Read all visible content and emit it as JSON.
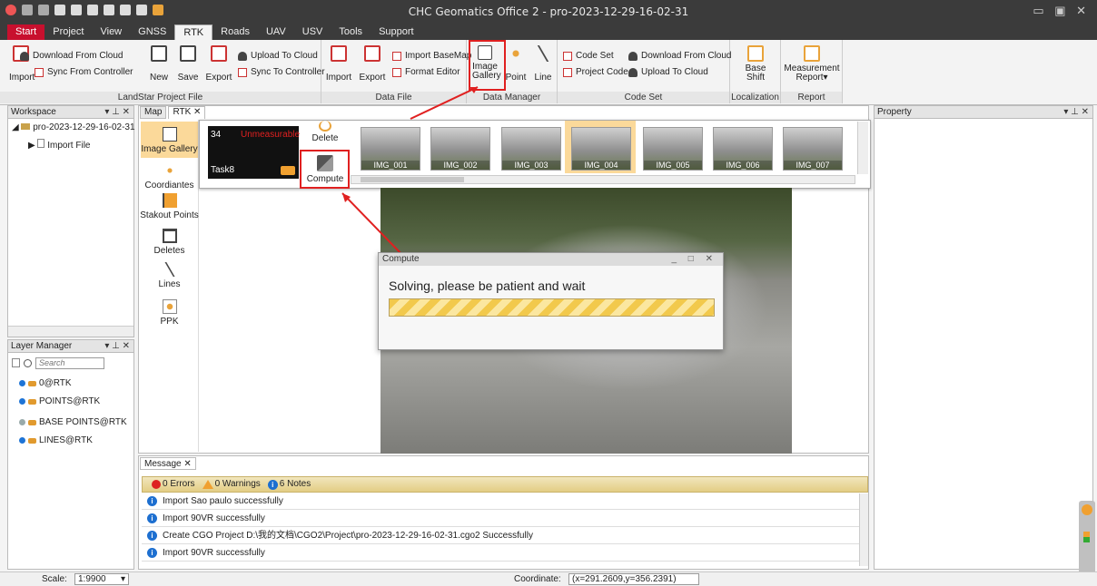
{
  "app": {
    "title": "CHC Geomatics Office 2 - pro-2023-12-29-16-02-31",
    "window_controls": "▭ ▣ ✕"
  },
  "menu": [
    "Start",
    "Project",
    "View",
    "GNSS",
    "RTK",
    "Roads",
    "UAV",
    "USV",
    "Tools",
    "Support"
  ],
  "ribbon": {
    "landstar": {
      "label": "LandStar Project File",
      "import": "Import",
      "download": "Download From Cloud",
      "sync_from": "Sync From Controller",
      "new": "New",
      "save": "Save",
      "export": "Export",
      "upload": "Upload To Cloud",
      "sync_to": "Sync To Controller"
    },
    "datafile": {
      "label": "Data File",
      "import": "Import",
      "export": "Export",
      "import_basemap": "Import BaseMap",
      "format_editor": "Format Editor"
    },
    "datamanager": {
      "label": "Data Manager",
      "image_gallery": "Image Gallery",
      "point": "Point",
      "line": "Line"
    },
    "codeset": {
      "label": "Code Set",
      "code_set": "Code Set",
      "project_code": "Project Code",
      "download": "Download From Cloud",
      "upload": "Upload To Cloud"
    },
    "localization": {
      "label": "Localization",
      "base_shift": "Base Shift"
    },
    "report": {
      "label": "Report",
      "measurement_report": "Measurement Report▾"
    }
  },
  "workspace": {
    "title": "Workspace",
    "controls": "▾ ⊥ ✕",
    "project": "pro-2023-12-29-16-02-31",
    "child": "Import File"
  },
  "layer_manager": {
    "title": "Layer Manager",
    "controls": "▾ ⊥ ✕",
    "search_placeholder": "Search",
    "layers": [
      "0@RTK",
      "POINTS@RTK",
      "BASE POINTS@RTK",
      "LINES@RTK"
    ]
  },
  "tabs": {
    "map": "Map",
    "rtk": "RTK ✕"
  },
  "side_tools": [
    "Image Gallery",
    "Coordiantes",
    "Stakout Points",
    "Deletes",
    "Lines",
    "PPK"
  ],
  "gallery": {
    "count": "34",
    "status": "Unmeasurable",
    "task": "Task8",
    "delete": "Delete",
    "compute": "Compute",
    "images": [
      "IMG_001",
      "IMG_002",
      "IMG_003",
      "IMG_004",
      "IMG_005",
      "IMG_006",
      "IMG_007"
    ],
    "selected_index": 3
  },
  "dialog": {
    "title": "Compute",
    "controls": "_ □ ✕",
    "message": "Solving, please be patient and wait"
  },
  "property": {
    "title": "Property",
    "controls": "▾ ⊥ ✕"
  },
  "message": {
    "tab": "Message ✕",
    "errors": "0 Errors",
    "warnings": "0 Warnings",
    "notes": "6 Notes",
    "rows": [
      "Import Sao paulo successfully",
      "Import 90VR successfully",
      "Create CGO Project D:\\我的文档\\CGO2\\Project\\pro-2023-12-29-16-02-31.cgo2 Successfully",
      "Import 90VR successfully"
    ]
  },
  "status": {
    "scale_label": "Scale:",
    "scale_value": "1:9900",
    "coord_label": "Coordinate:",
    "coord_value": "(x=291.2609,y=356.2391)"
  },
  "colors": {
    "highlight": "#e02020",
    "brand": "#c8102e"
  }
}
